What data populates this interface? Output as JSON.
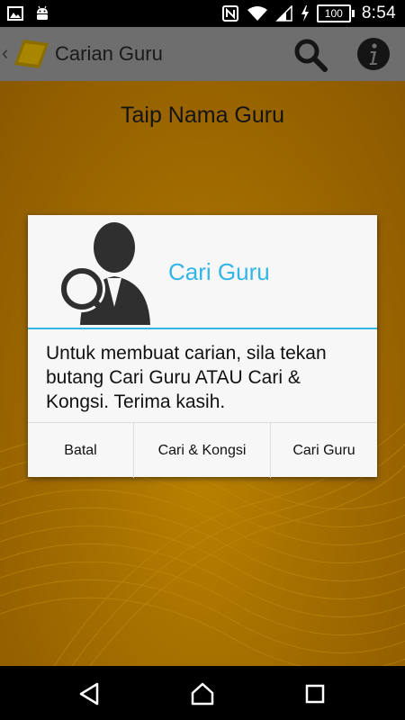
{
  "status_bar": {
    "battery_level": "100",
    "time": "8:54",
    "icons": [
      "image-icon",
      "android-icon",
      "nfc-icon",
      "wifi-icon",
      "signal-icon",
      "charging-icon",
      "battery-icon"
    ]
  },
  "app_bar": {
    "title": "Carian Guru",
    "icons": [
      "back-chevron-icon",
      "app-logo-icon",
      "search-icon",
      "info-icon"
    ]
  },
  "page": {
    "heading": "Taip Nama Guru"
  },
  "dialog": {
    "title": "Cari Guru",
    "icon": "user-search-icon",
    "message": "Untuk membuat carian, sila tekan butang Cari Guru ATAU Cari & Kongsi. Terima kasih.",
    "buttons": {
      "cancel": "Batal",
      "search_share": "Cari & Kongsi",
      "search": "Cari Guru"
    }
  },
  "nav_bar": {
    "icons": [
      "back-icon",
      "home-icon",
      "recents-icon"
    ]
  },
  "colors": {
    "accent": "#33b5e5",
    "background_orange": "#a36d00",
    "dialog_background": "#f7f7f7"
  }
}
